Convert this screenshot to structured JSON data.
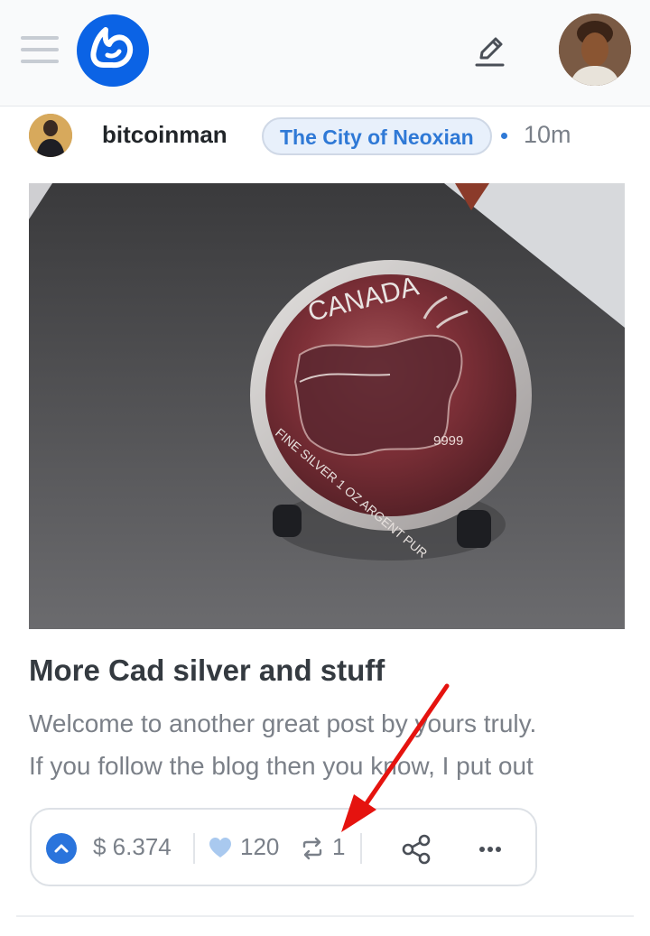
{
  "header": {
    "menu_icon": "hamburger-icon",
    "logo_icon": "ecency-logo",
    "edit_icon": "pencil-icon",
    "avatar_icon": "user-avatar",
    "brand_color": "#0b63e5"
  },
  "post": {
    "author": "bitcoinman",
    "community": "The City of Neoxian",
    "time": "10m",
    "image": {
      "coin_top_text": "CANADA",
      "coin_bottom_text": "FINE SILVER 1 OZ ARGENT PUR",
      "coin_purity": "9999"
    },
    "title": "More Cad silver and stuff",
    "excerpt_line1": "Welcome to another great post by yours truly.",
    "excerpt_line2": "If you follow the blog then you know, I put out"
  },
  "actions": {
    "payout": "$ 6.374",
    "votes": "120",
    "reblogs": "1",
    "upvote_icon": "chevron-up-icon",
    "heart_icon": "heart-icon",
    "reblog_icon": "repeat-icon",
    "share_icon": "share-icon",
    "more_icon": "more-icon",
    "accent": "#2a74dc"
  },
  "annotation": {
    "arrow_color": "#e5130f"
  }
}
